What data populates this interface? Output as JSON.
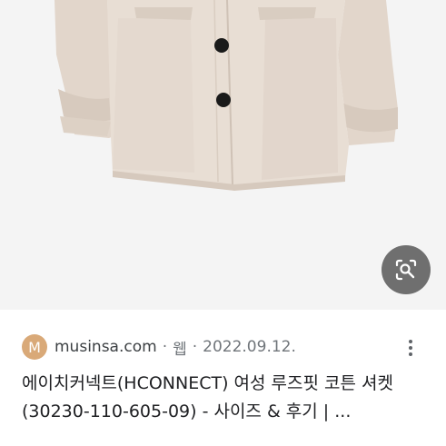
{
  "image": {
    "alt_icon": "jacket-product-image",
    "lens_icon": "lens-search-icon"
  },
  "result": {
    "favicon_letter": "M",
    "site": "musinsa.com",
    "separator": "·",
    "type": "웹",
    "date": "2022.09.12.",
    "title": "에이치커넥트(HCONNECT) 여성 루즈핏 코튼 셔켓(30230-110-605-09) - 사이즈 & 후기 | ..."
  },
  "colors": {
    "favicon_bg": "#d9a978",
    "jacket": "#e4d9cf",
    "lens_button": "#6f6f6f"
  }
}
